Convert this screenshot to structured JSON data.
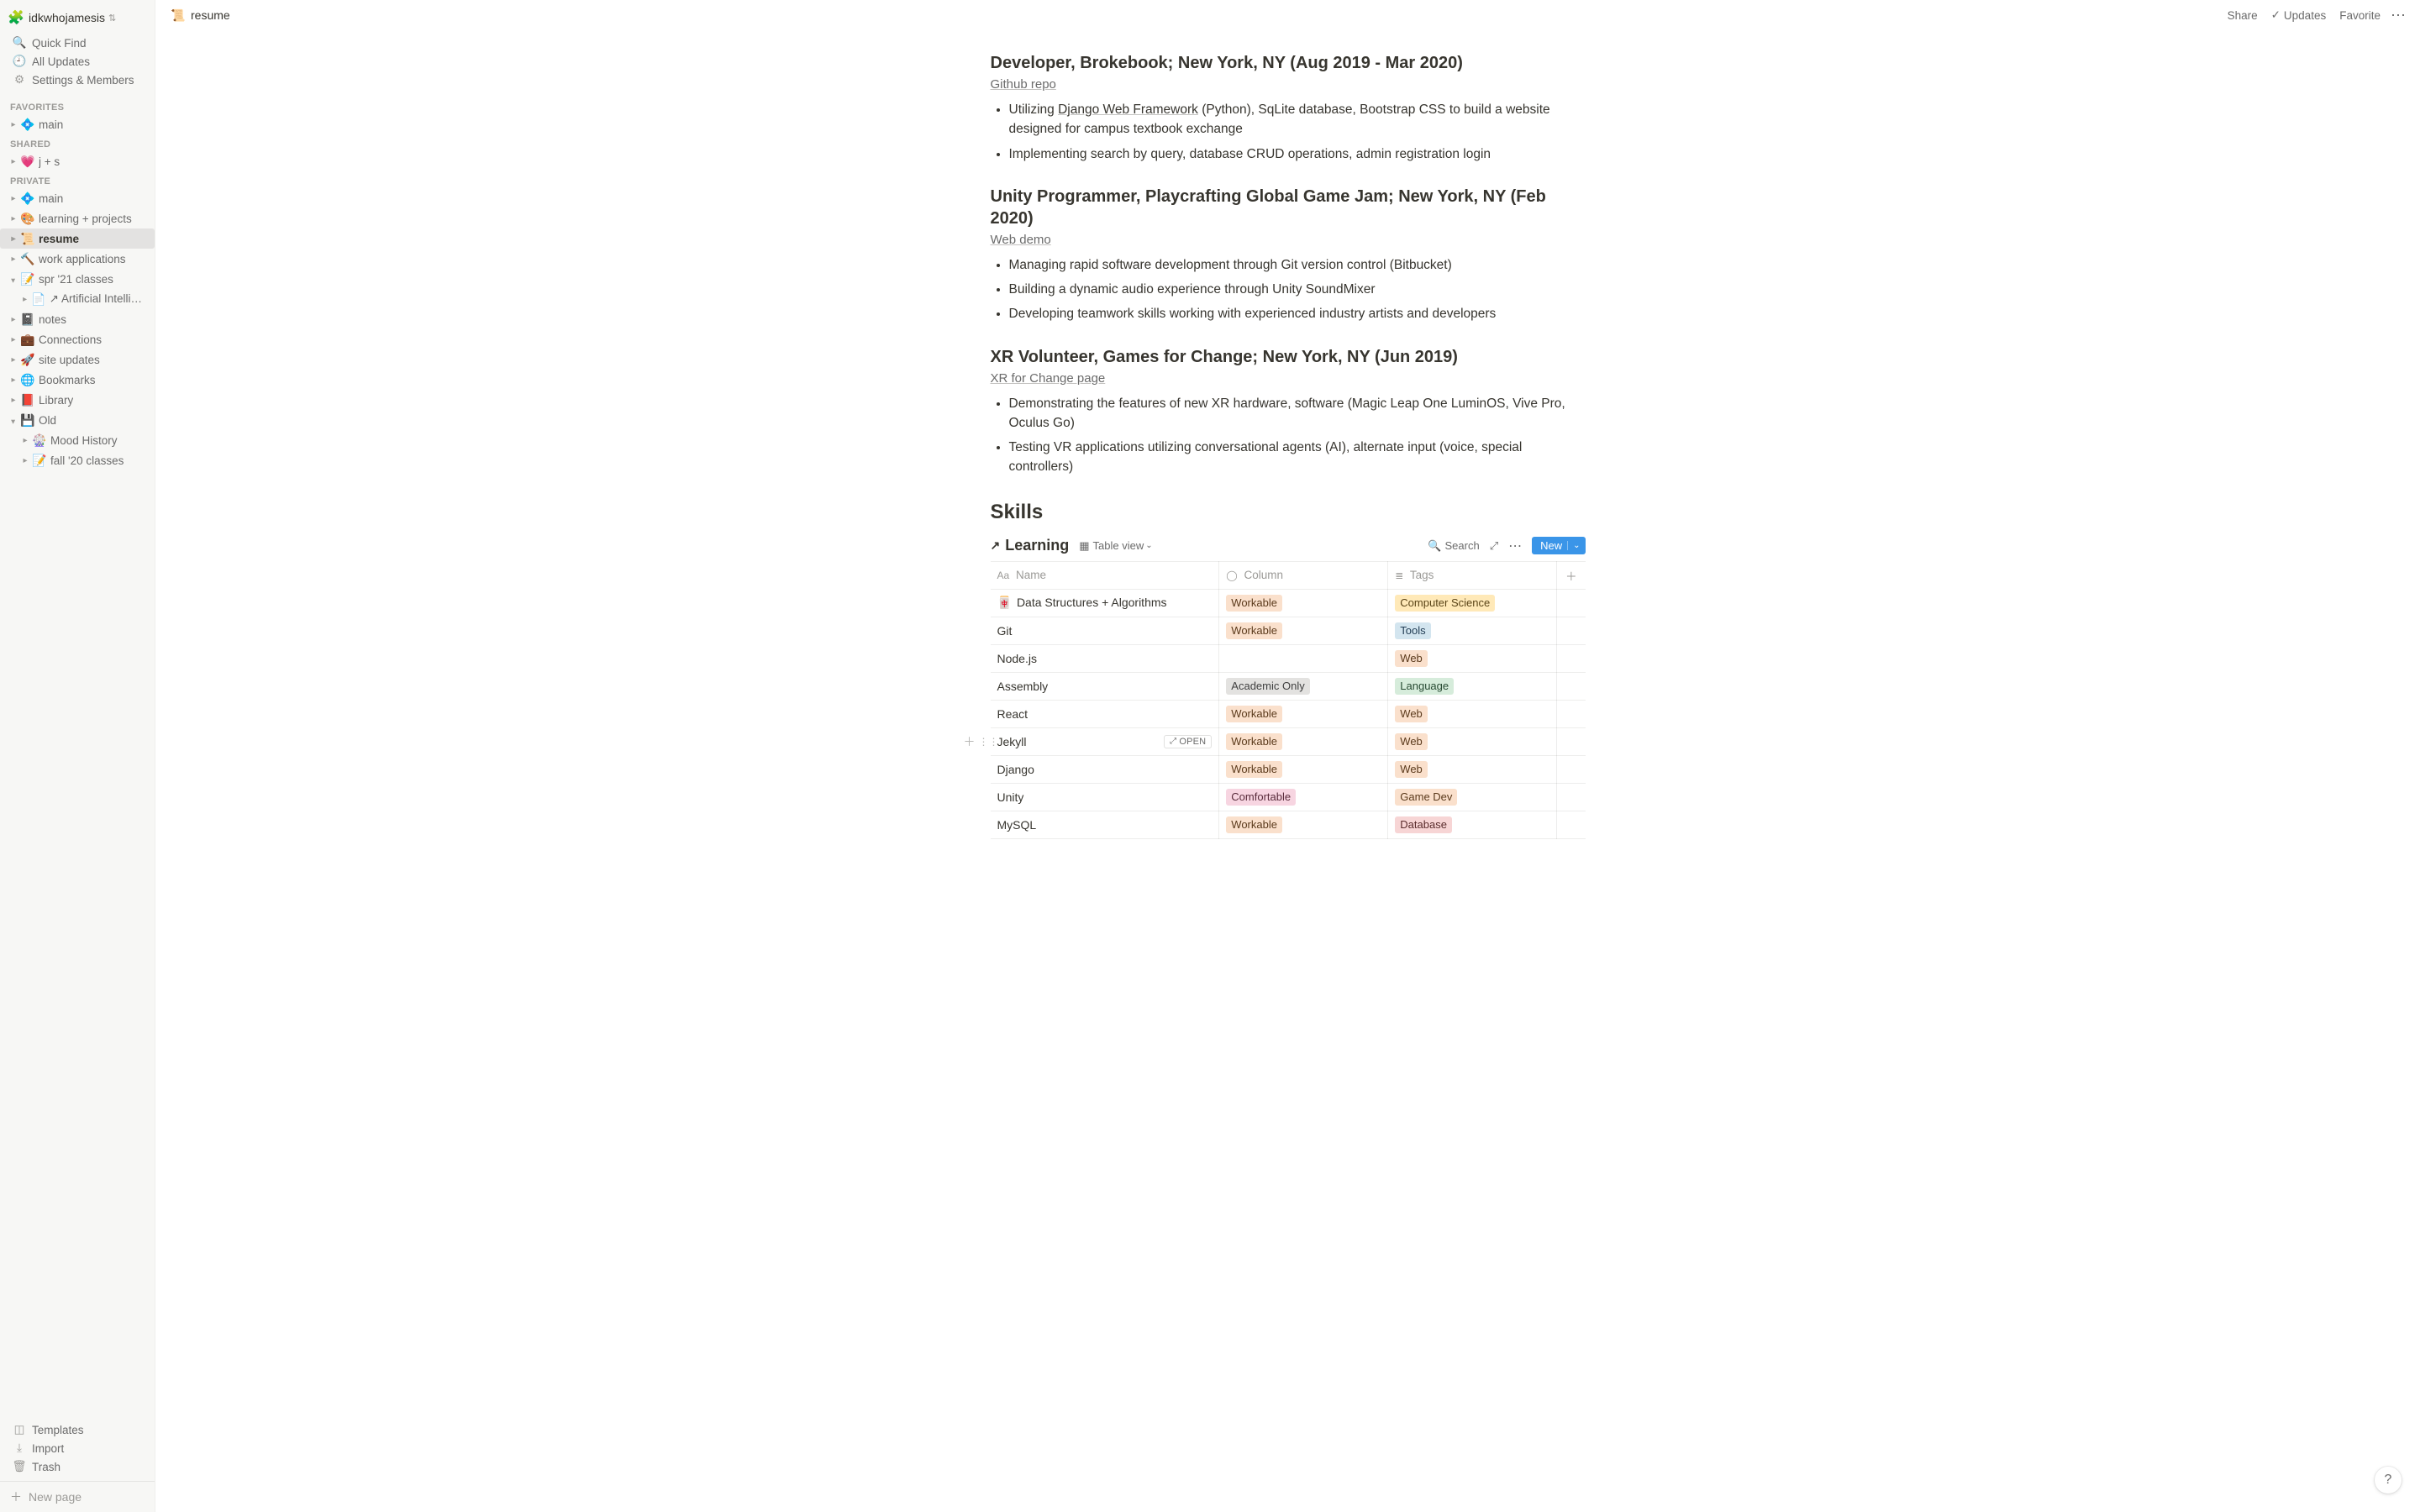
{
  "workspace": {
    "name": "idkwhojamesis",
    "icon": "🧩"
  },
  "sidebar": {
    "quick_find": "Quick Find",
    "all_updates": "All Updates",
    "settings": "Settings & Members",
    "sections": {
      "favorites": "FAVORITES",
      "shared": "SHARED",
      "private": "PRIVATE"
    },
    "favorites": [
      {
        "emoji": "💠",
        "label": "main"
      }
    ],
    "shared": [
      {
        "emoji": "💗",
        "label": "j + s"
      }
    ],
    "private": [
      {
        "emoji": "💠",
        "label": "main"
      },
      {
        "emoji": "🎨",
        "label": "learning + projects"
      },
      {
        "emoji": "📜",
        "label": "resume",
        "selected": true
      },
      {
        "emoji": "🔨",
        "label": "work applications"
      },
      {
        "emoji": "📝",
        "label": "spr '21 classes",
        "open": true,
        "children": [
          {
            "emoji": "📄",
            "label": "↗ Artificial Intellige…"
          }
        ]
      },
      {
        "emoji": "📓",
        "label": "notes"
      },
      {
        "emoji": "💼",
        "label": "Connections"
      },
      {
        "emoji": "🚀",
        "label": "site updates"
      },
      {
        "emoji": "🌐",
        "label": "Bookmarks"
      },
      {
        "emoji": "📕",
        "label": "Library"
      },
      {
        "emoji": "💾",
        "label": "Old",
        "open": true,
        "children": [
          {
            "emoji": "🎡",
            "label": "Mood History"
          },
          {
            "emoji": "📝",
            "label": "fall '20 classes"
          }
        ]
      }
    ],
    "templates": "Templates",
    "import": "Import",
    "trash": "Trash",
    "new_page": "New page"
  },
  "topbar": {
    "breadcrumb_emoji": "📜",
    "breadcrumb_label": "resume",
    "share": "Share",
    "updates": "Updates",
    "favorite": "Favorite"
  },
  "body": {
    "entries": [
      {
        "title": "Developer, Brokebook; New York, NY (Aug 2019 - Mar 2020)",
        "link": "Github repo",
        "bullets": [
          {
            "pre": "Utilizing ",
            "link": "Django Web Framework",
            "post": " (Python), SqLite database, Bootstrap CSS to build a website designed for campus textbook exchange"
          },
          {
            "text": "Implementing search by query, database CRUD operations, admin registration login"
          }
        ]
      },
      {
        "title": "Unity Programmer, Playcrafting Global Game Jam; New York, NY (Feb 2020)",
        "link": "Web demo",
        "bullets": [
          {
            "text": "Managing rapid software development through Git version control (Bitbucket)"
          },
          {
            "text": "Building a dynamic audio experience through Unity SoundMixer"
          },
          {
            "text": "Developing teamwork skills working with experienced industry artists and developers"
          }
        ]
      },
      {
        "title": "XR Volunteer, Games for Change; New York, NY (Jun 2019)",
        "link": "XR for Change page",
        "bullets": [
          {
            "text": "Demonstrating the features of new XR hardware, software (Magic Leap One LuminOS, Vive Pro, Oculus Go)"
          },
          {
            "text": "Testing VR applications utilizing conversational agents (AI), alternate input (voice, special controllers)"
          }
        ]
      }
    ],
    "section_title": "Skills"
  },
  "db": {
    "title": "Learning",
    "view_label": "Table view",
    "search_label": "Search",
    "new_label": "New",
    "columns": {
      "name": "Name",
      "column": "Column",
      "tags": "Tags"
    },
    "open_label": "OPEN",
    "rows": [
      {
        "icon": "🀄",
        "name": "Data Structures + Algorithms",
        "column": {
          "text": "Workable",
          "cls": "tag-orange"
        },
        "tag": {
          "text": "Computer Science",
          "cls": "tag-yellow"
        }
      },
      {
        "name": "Git",
        "column": {
          "text": "Workable",
          "cls": "tag-orange"
        },
        "tag": {
          "text": "Tools",
          "cls": "tag-blue"
        }
      },
      {
        "name": "Node.js",
        "column": null,
        "tag": {
          "text": "Web",
          "cls": "tag-orange"
        }
      },
      {
        "name": "Assembly",
        "column": {
          "text": "Academic Only",
          "cls": "tag-gray"
        },
        "tag": {
          "text": "Language",
          "cls": "tag-green"
        }
      },
      {
        "name": "React",
        "column": {
          "text": "Workable",
          "cls": "tag-orange"
        },
        "tag": {
          "text": "Web",
          "cls": "tag-orange"
        }
      },
      {
        "name": "Jekyll",
        "column": {
          "text": "Workable",
          "cls": "tag-orange"
        },
        "tag": {
          "text": "Web",
          "cls": "tag-orange"
        },
        "hovered": true
      },
      {
        "name": "Django",
        "column": {
          "text": "Workable",
          "cls": "tag-orange"
        },
        "tag": {
          "text": "Web",
          "cls": "tag-orange"
        }
      },
      {
        "name": "Unity",
        "column": {
          "text": "Comfortable",
          "cls": "tag-pink"
        },
        "tag": {
          "text": "Game Dev",
          "cls": "tag-orange"
        }
      },
      {
        "name": "MySQL",
        "column": {
          "text": "Workable",
          "cls": "tag-orange"
        },
        "tag": {
          "text": "Database",
          "cls": "tag-red"
        }
      }
    ]
  },
  "help": "?"
}
